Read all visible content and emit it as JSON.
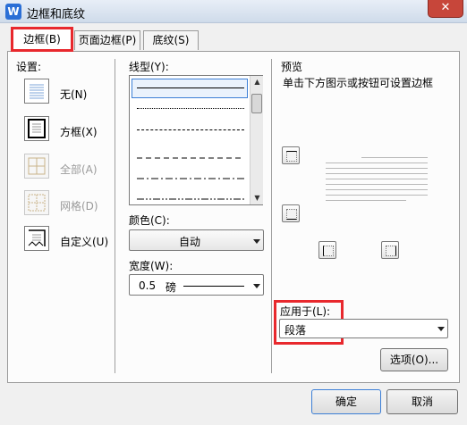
{
  "window": {
    "title": "边框和底纹",
    "app_icon_letter": "W",
    "close_glyph": "✕"
  },
  "tabs": [
    {
      "label": "边框(B)"
    },
    {
      "label": "页面边框(P)"
    },
    {
      "label": "底纹(S)"
    }
  ],
  "settings": {
    "heading": "设置:",
    "options": [
      {
        "label": "无(N)",
        "enabled": true
      },
      {
        "label": "方框(X)",
        "enabled": true
      },
      {
        "label": "全部(A)",
        "enabled": false
      },
      {
        "label": "网格(D)",
        "enabled": false
      },
      {
        "label": "自定义(U)",
        "enabled": true
      }
    ]
  },
  "style": {
    "label": "线型(Y):",
    "selected_index": 0
  },
  "color": {
    "label": "颜色(C):",
    "value": "自动"
  },
  "width": {
    "label": "宽度(W):",
    "value": "0.5",
    "unit": "磅"
  },
  "preview": {
    "heading": "预览",
    "hint": "单击下方图示或按钮可设置边框"
  },
  "apply_to": {
    "label": "应用于(L):",
    "value": "段落"
  },
  "buttons": {
    "options": "选项(O)...",
    "ok": "确定",
    "cancel": "取消"
  },
  "colors": {
    "highlight_red": "#e8282d",
    "selection_blue": "#3c7fd6"
  }
}
